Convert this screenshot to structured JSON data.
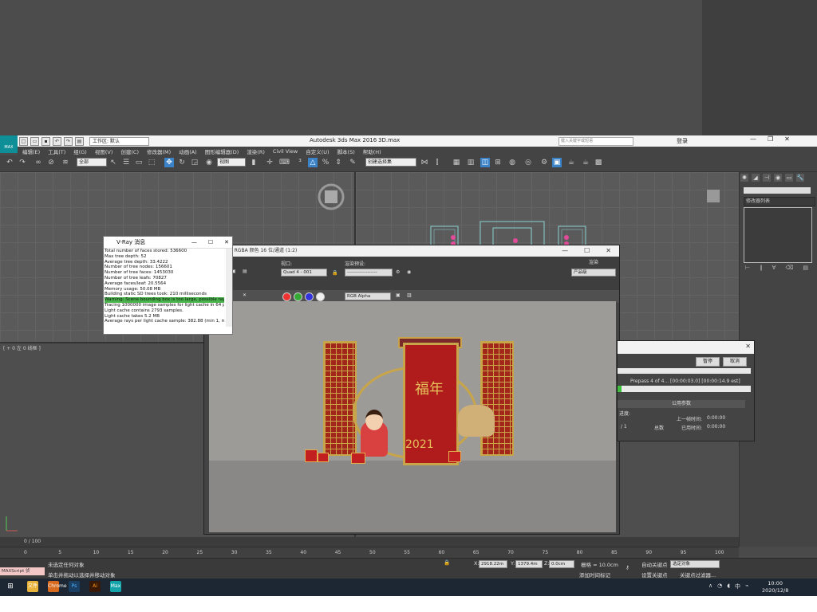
{
  "app": {
    "title": "Autodesk 3ds Max 2016",
    "file": "3D.max",
    "logo": "MAX",
    "workspace": "工作区: 默认",
    "search_placeholder": "键入关键字或短语",
    "login": "登录"
  },
  "menu": [
    "编辑(E)",
    "工具(T)",
    "组(G)",
    "视图(V)",
    "创建(C)",
    "修改器(M)",
    "动画(A)",
    "图形编辑器(D)",
    "渲染(R)",
    "Civil View",
    "自定义(U)",
    "脚本(S)",
    "帮助(H)"
  ],
  "toolbar": {
    "filter": "全部",
    "ref_coord": "视图",
    "selection_set": "创建选择集"
  },
  "viewports": {
    "bottom_left_label": "[ + 0 左 0 线框 ]"
  },
  "command_panel": {
    "modifier_list": "修改器列表"
  },
  "vray_messages": {
    "title": "V-Ray 消息",
    "lines": [
      "Total number of faces stored: 536600",
      "Max tree depth: 52",
      "Average tree depth: 33.4222",
      "Number of tree nodes: 156601",
      "Number of tree faces: 1453030",
      "Number of tree leafs: 70827",
      "Average faces/leaf: 20.5564",
      "Memory usage: 50.08 MB",
      "Building static SD trees took: 210 milliseconds",
      "Warning: Scene bounding box is too large, possible raycast e",
      "Tracing 1000000 image samples for light cache in 64 passes",
      "Light cache contains 2793 samples.",
      "Light cache takes 5.2 MB",
      "Average rays per light cache sample: 382.88 (min 1, max 26:"
    ],
    "highlight_index": 9
  },
  "frame_buffer": {
    "title": "0, RGBA 颜色 16 位/通道 (1:2)",
    "render_label": "渲染",
    "viewport_label": "视口:",
    "viewport_value": "Quad 4 - 001",
    "preset_label": "渲染预设:",
    "preset_value": "-------------------",
    "product_value": "产品级",
    "channel_value": "RGB Alpha",
    "image_banner_text": "福年",
    "image_year_text": "2021"
  },
  "progress": {
    "pause": "暂停",
    "cancel": "取消",
    "prepass_text": "Prepass 4 of 4... [00:00:03.0] [00:00:14.9 est]",
    "prepass_fraction": 0.03,
    "common_params": "公用参数",
    "fields": {
      "progress_label": "进度:",
      "slash": "/ 1",
      "total_label": "总数",
      "last_time_label": "上一帧时间:",
      "last_time_value": "0:00:00",
      "elapsed_label": "已用时间:",
      "elapsed_value": "0:00:00"
    }
  },
  "timeline": {
    "frame": "0 / 100",
    "ticks": [
      "0",
      "5",
      "10",
      "15",
      "20",
      "25",
      "30",
      "35",
      "40",
      "45",
      "50",
      "55",
      "60",
      "65",
      "70",
      "75",
      "80",
      "85",
      "90",
      "95",
      "100"
    ]
  },
  "status": {
    "maxscript": "MAXScript 侦",
    "none_selected": "未选定任何对象",
    "hint": "单击并拖动以选择并移动对象",
    "x_label": "X:",
    "x_value": "2918.22m",
    "y_label": "Y:",
    "y_value": "1379.4m",
    "z_label": "Z:",
    "z_value": "0.0cm",
    "grid": "栅格 = 10.0cm",
    "add_time_tag": "添加时间标记",
    "auto_key": "自动关键点",
    "set_key": "设置关键点",
    "selected_object": "选定对象",
    "key_filters": "关键点过滤器..."
  },
  "taskbar": {
    "time": "10:00",
    "date": "2020/12/8",
    "ime": "中",
    "apps": [
      "文件",
      "Chrome",
      "Ps",
      "Ai",
      "Max"
    ]
  }
}
